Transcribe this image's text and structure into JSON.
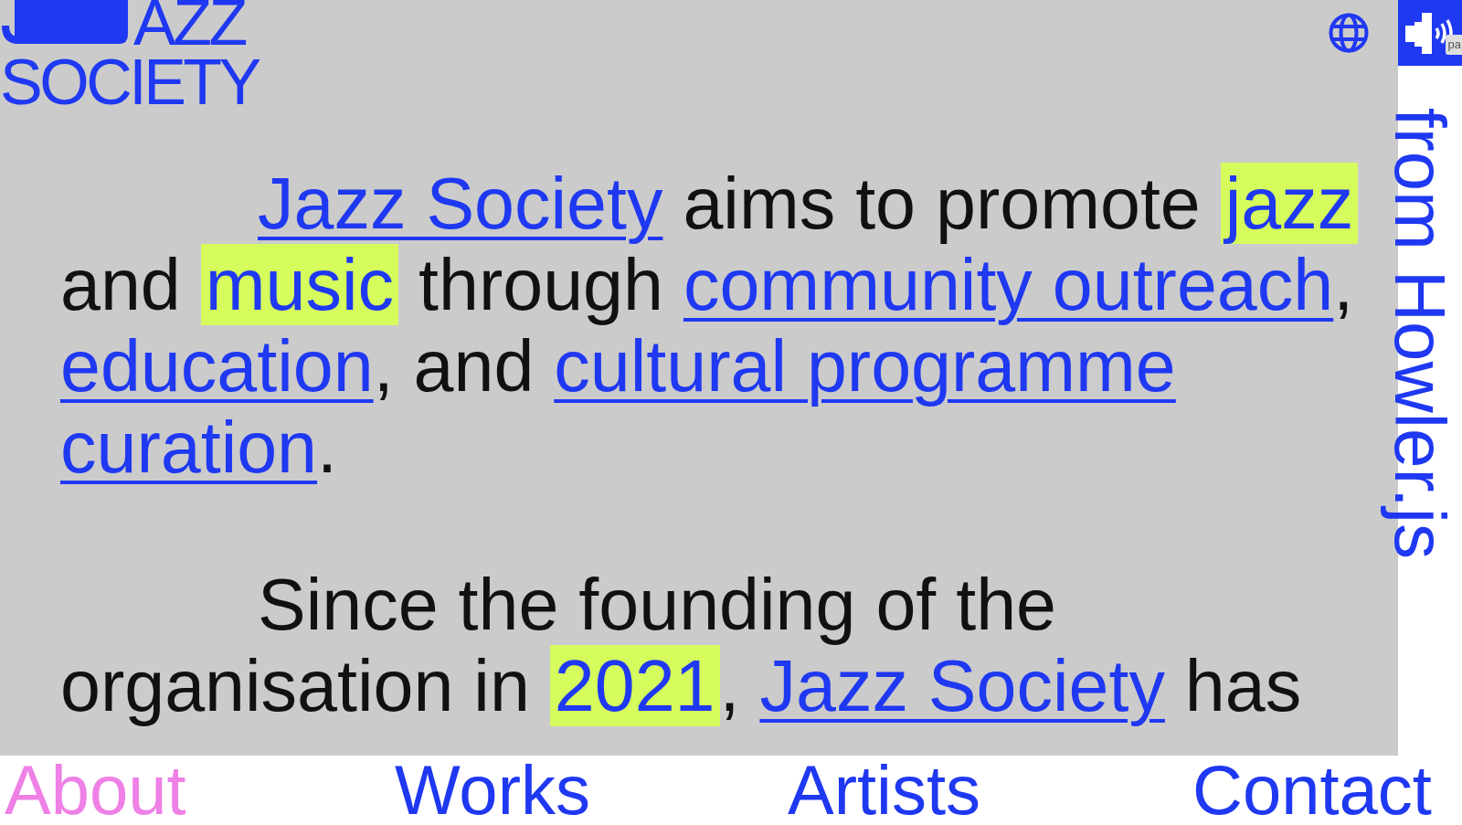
{
  "header": {
    "logo": {
      "line_1": "AZZ",
      "line_2": "SOCIETY"
    }
  },
  "paragraphs": [
    {
      "segments": [
        {
          "kind": "link",
          "text": "Jazz Society"
        },
        {
          "kind": "text",
          "text": " aims to promote "
        },
        {
          "kind": "highlight",
          "text": "jazz"
        },
        {
          "kind": "text",
          "text": " and "
        },
        {
          "kind": "highlight",
          "text": "music"
        },
        {
          "kind": "text",
          "text": " through "
        },
        {
          "kind": "link",
          "text": "community outreach"
        },
        {
          "kind": "text",
          "text": ", "
        },
        {
          "kind": "link",
          "text": "education"
        },
        {
          "kind": "text",
          "text": ", and "
        },
        {
          "kind": "link",
          "text": "cultural programme"
        },
        {
          "kind": "link",
          "text": "curation",
          "space_before": true
        },
        {
          "kind": "text",
          "text": "."
        }
      ]
    },
    {
      "segments": [
        {
          "kind": "text",
          "text": "Since the founding of the organisation in "
        },
        {
          "kind": "highlight",
          "text": "2021"
        },
        {
          "kind": "text",
          "text": ", "
        },
        {
          "kind": "link",
          "text": "Jazz Society"
        },
        {
          "kind": "text",
          "text": " has"
        }
      ]
    }
  ],
  "sidebar": {
    "track_title": "from Howler.js",
    "tooltip": "pa"
  },
  "nav": [
    {
      "label": "About",
      "selected": true
    },
    {
      "label": "Works",
      "selected": false
    },
    {
      "label": "Artists",
      "selected": false
    },
    {
      "label": "Contact",
      "selected": false
    }
  ]
}
